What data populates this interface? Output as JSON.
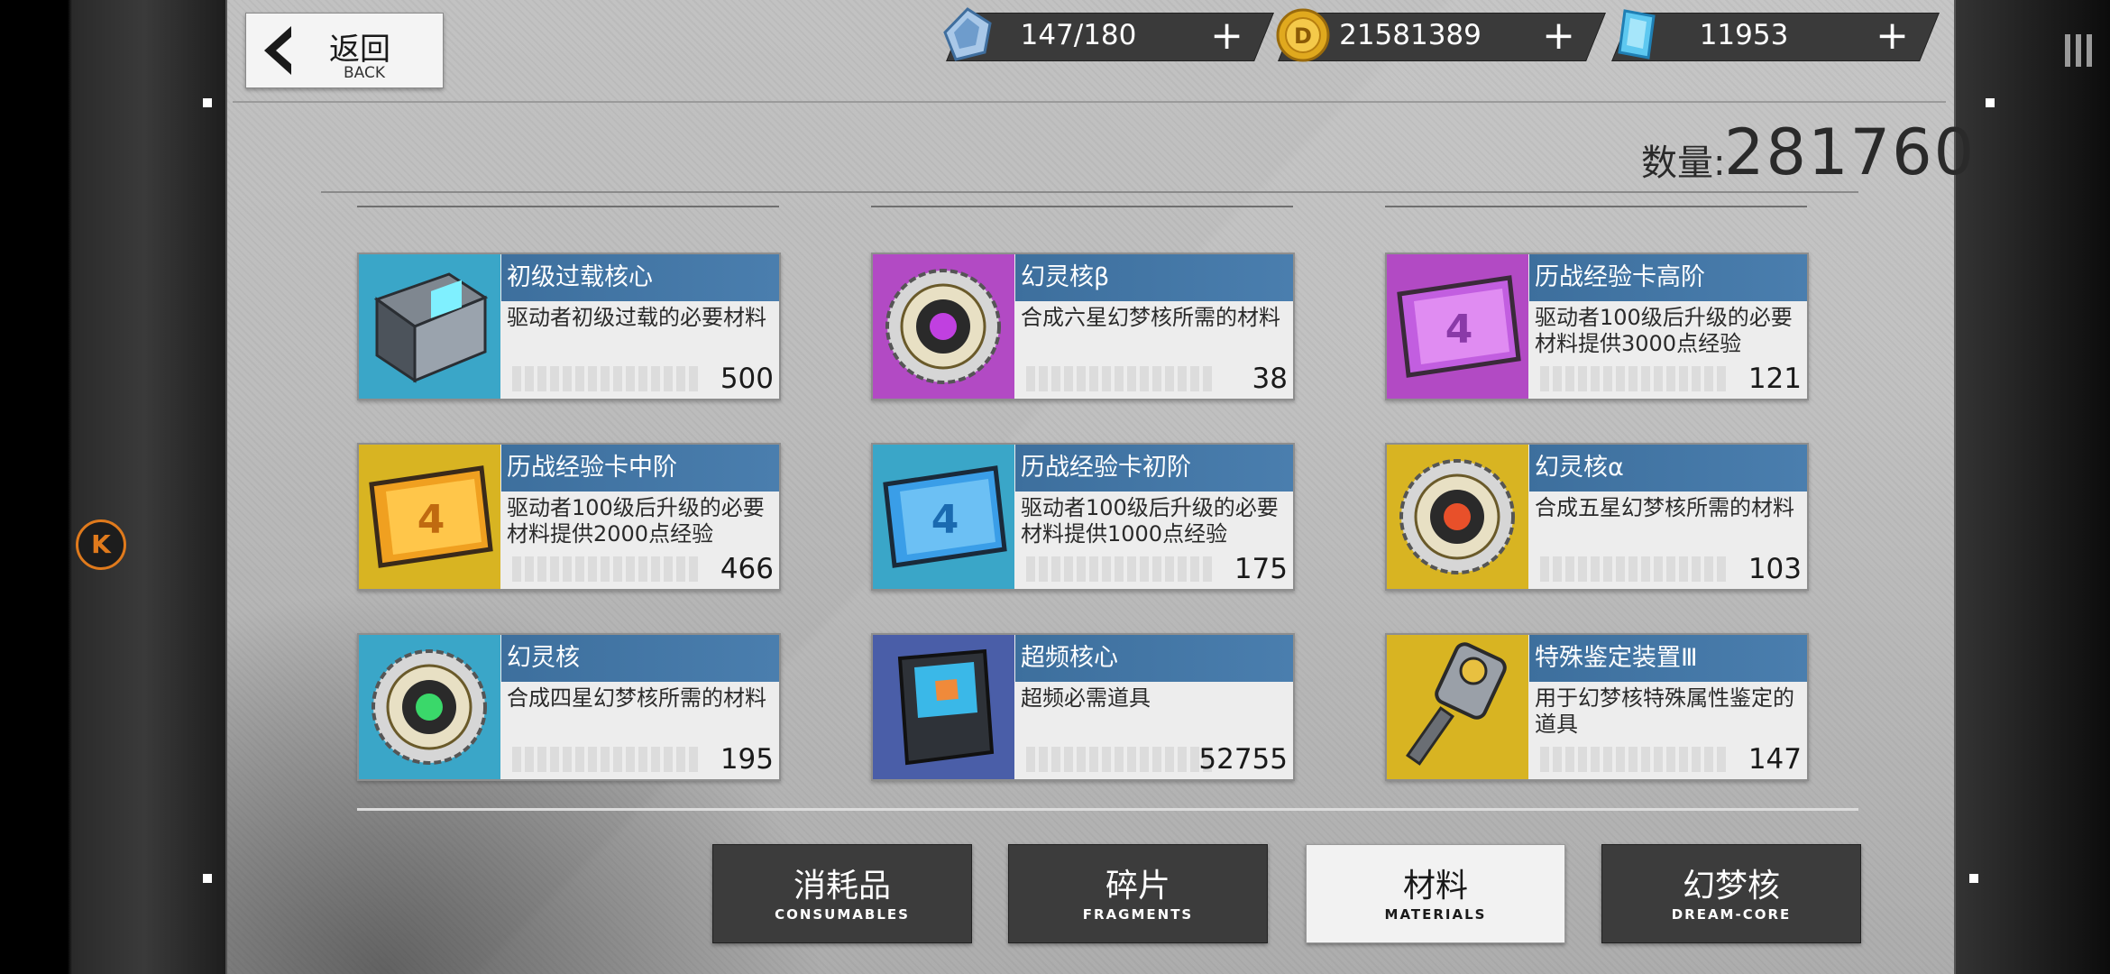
{
  "header": {
    "back_label_cn": "返回",
    "back_label_en": "BACK",
    "resources": [
      {
        "name": "stamina",
        "icon": "stamina-crystal-icon",
        "value": "147/180",
        "plus": "+"
      },
      {
        "name": "coins",
        "icon": "gold-coin-icon",
        "value": "21581389",
        "plus": "+"
      },
      {
        "name": "diamonds",
        "icon": "blue-diamond-icon",
        "value": "11953",
        "plus": "+"
      }
    ]
  },
  "inventory": {
    "quantity_label": "数量:",
    "quantity_value": "281760"
  },
  "items": [
    {
      "name": "初级过载核心",
      "desc": "驱动者初级过载的必要材料",
      "count": "500",
      "icon": "overload-core-icon",
      "bg": "#3aa6c8"
    },
    {
      "name": "幻灵核β",
      "desc": "合成六星幻梦核所需的材料",
      "count": "38",
      "icon": "phantom-core-beta-icon",
      "bg": "#b24ac4"
    },
    {
      "name": "历战经验卡高阶",
      "desc": "驱动者100级后升级的必要材料提供3000点经验",
      "count": "121",
      "icon": "exp-card-purple-icon",
      "bg": "#b24ac4"
    },
    {
      "name": "历战经验卡中阶",
      "desc": "驱动者100级后升级的必要材料提供2000点经验",
      "count": "466",
      "icon": "exp-card-orange-icon",
      "bg": "#d8b422"
    },
    {
      "name": "历战经验卡初阶",
      "desc": "驱动者100级后升级的必要材料提供1000点经验",
      "count": "175",
      "icon": "exp-card-blue-icon",
      "bg": "#3aa6c8"
    },
    {
      "name": "幻灵核α",
      "desc": "合成五星幻梦核所需的材料",
      "count": "103",
      "icon": "phantom-core-alpha-icon",
      "bg": "#d8b422"
    },
    {
      "name": "幻灵核",
      "desc": "合成四星幻梦核所需的材料",
      "count": "195",
      "icon": "phantom-core-icon",
      "bg": "#3aa6c8"
    },
    {
      "name": "超频核心",
      "desc": "超频必需道具",
      "count": "52755",
      "icon": "overclock-core-icon",
      "bg": "#4a5ea8"
    },
    {
      "name": "特殊鉴定装置Ⅲ",
      "desc": "用于幻梦核特殊属性鉴定的道具",
      "count": "147",
      "icon": "appraisal-device-icon",
      "bg": "#d8b422"
    }
  ],
  "tabs": [
    {
      "cn": "消耗品",
      "en": "CONSUMABLES",
      "active": false
    },
    {
      "cn": "碎片",
      "en": "FRAGMENTS",
      "active": false
    },
    {
      "cn": "材料",
      "en": "MATERIALS",
      "active": true
    },
    {
      "cn": "幻梦核",
      "en": "DREAM-CORE",
      "active": false
    }
  ],
  "side": {
    "k_label": "K"
  },
  "colors": {
    "title_bar": "#3d6f9d",
    "tab_dark": "#3c3c3c",
    "tab_active": "#f2f2f2",
    "accent_orange": "#e07a1c"
  }
}
